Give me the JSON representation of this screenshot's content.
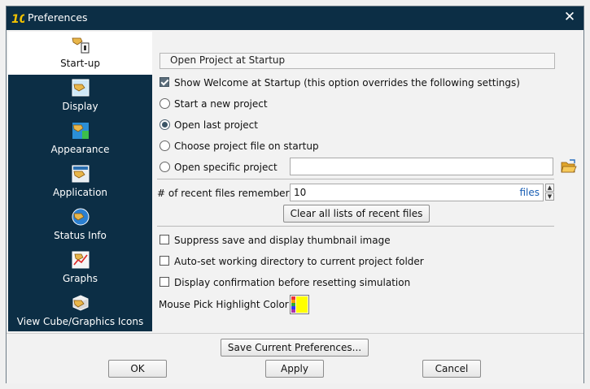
{
  "window": {
    "title": "Preferences",
    "close_label": "✕"
  },
  "sidebar": {
    "items": [
      {
        "label": "Start-up",
        "icon": "startup-icon",
        "selected": true
      },
      {
        "label": "Display",
        "icon": "display-icon"
      },
      {
        "label": "Appearance",
        "icon": "appearance-icon"
      },
      {
        "label": "Application",
        "icon": "application-icon"
      },
      {
        "label": "Status Info",
        "icon": "status-info-icon"
      },
      {
        "label": "Graphs",
        "icon": "graphs-icon"
      },
      {
        "label": "View Cube/Graphics Icons",
        "icon": "view-cube-icon"
      }
    ]
  },
  "startup": {
    "group_title": "Open Project at Startup",
    "show_welcome": {
      "label": "Show Welcome at Startup (this option overrides the following settings)",
      "checked": true
    },
    "options": [
      {
        "label": "Start a new project",
        "checked": false
      },
      {
        "label": "Open last project",
        "checked": true
      },
      {
        "label": "Choose project file on startup",
        "checked": false
      },
      {
        "label": "Open specific project",
        "checked": false
      }
    ],
    "specific_project_path": "",
    "recent_files_label": "# of recent files remembered",
    "recent_files_value": "10",
    "recent_files_unit": "files",
    "clear_button": "Clear all lists of recent files",
    "suppress_thumbnail": {
      "label": "Suppress save and display thumbnail image",
      "checked": false
    },
    "auto_set_dir": {
      "label": "Auto-set working directory to current project folder",
      "checked": false
    },
    "confirm_reset": {
      "label": "Display confirmation before resetting simulation",
      "checked": false
    },
    "highlight_label": "Mouse Pick Highlight Color",
    "highlight_color": "#ffff00"
  },
  "footer": {
    "save_prefs": "Save Current Preferences...",
    "ok": "OK",
    "apply": "Apply",
    "cancel": "Cancel"
  },
  "colors": {
    "sidebar_bg": "#0c2e45",
    "accent": "#1a5fb4"
  }
}
